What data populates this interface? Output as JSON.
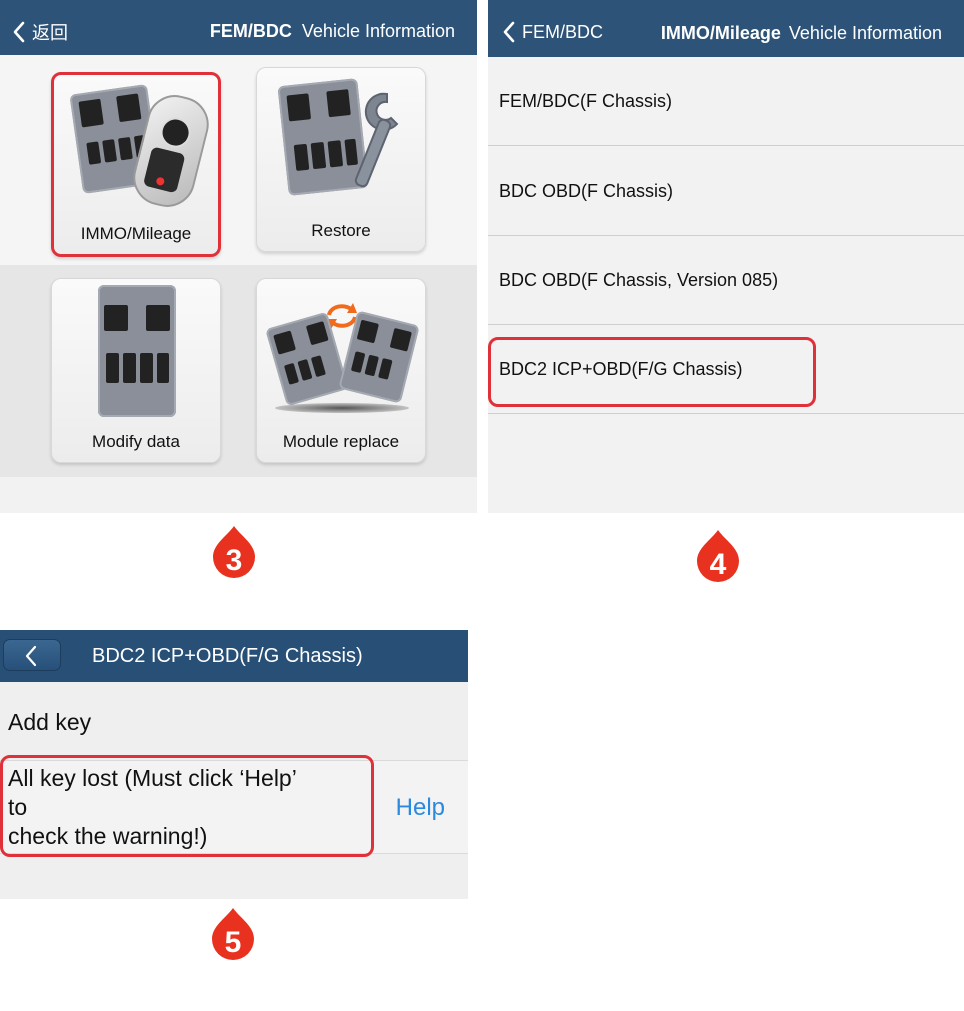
{
  "colors": {
    "header_bg": "#2d5378",
    "highlight": "#e0313a",
    "help_link": "#2a8ae0",
    "marker": "#e8321f"
  },
  "panel3": {
    "back_label": "返回",
    "title_bold": "FEM/BDC",
    "title": "Vehicle Information",
    "tiles": [
      {
        "label": "IMMO/Mileage",
        "icon": "module-with-key-icon",
        "highlighted": true
      },
      {
        "label": "Restore",
        "icon": "module-with-wrench-icon"
      },
      {
        "label": "Modify data",
        "icon": "module-icon"
      },
      {
        "label": "Module replace",
        "icon": "module-swap-icon"
      }
    ],
    "marker": "3"
  },
  "panel4": {
    "back_label": "FEM/BDC",
    "title_bold": "IMMO/Mileage",
    "title": "Vehicle Information",
    "items": [
      {
        "label": "FEM/BDC(F Chassis)"
      },
      {
        "label": "BDC OBD(F Chassis)"
      },
      {
        "label": "BDC OBD(F Chassis, Version 085)"
      },
      {
        "label": "BDC2 ICP+OBD(F/G Chassis)",
        "highlighted": true
      }
    ],
    "marker": "4"
  },
  "panel5": {
    "title": "BDC2 ICP+OBD(F/G Chassis)",
    "rows": [
      {
        "line1": "Add key"
      },
      {
        "line1": "All key lost (Must click ‘Help’",
        "line2": "to",
        "line3": "check the warning!)",
        "highlighted": true
      }
    ],
    "help_label": "Help",
    "marker": "5"
  }
}
